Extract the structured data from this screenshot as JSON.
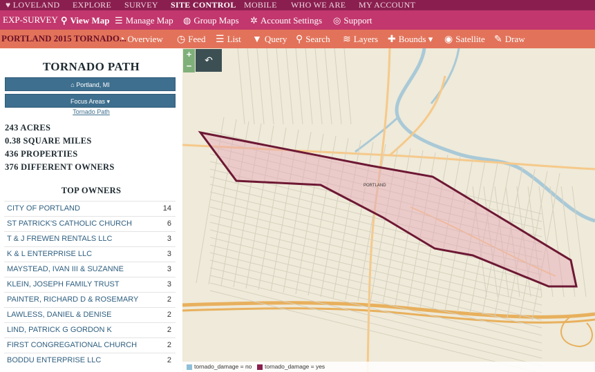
{
  "top_nav": {
    "items": [
      {
        "label": "♥ LOVELAND",
        "active": false
      },
      {
        "label": "EXPLORE",
        "active": false
      },
      {
        "label": "SURVEY",
        "active": false
      },
      {
        "label": "SITE CONTROL",
        "active": true
      },
      {
        "label": "MOBILE",
        "active": false
      },
      {
        "label": "WHO WE ARE",
        "active": false
      },
      {
        "label": "MY ACCOUNT",
        "active": false
      }
    ]
  },
  "sub_nav": {
    "brand": "EXP-SURVEY",
    "links": [
      {
        "label": "View Map",
        "icon": "map-pin-icon",
        "active": true
      },
      {
        "label": "Manage Map",
        "icon": "sliders-icon",
        "active": false
      },
      {
        "label": "Group Maps",
        "icon": "group-icon",
        "active": false
      },
      {
        "label": "Account Settings",
        "icon": "gear-icon",
        "active": false
      },
      {
        "label": "Support",
        "icon": "lifebuoy-icon",
        "active": false
      }
    ]
  },
  "toolbar": {
    "title": "PORTLAND 2015 TORNADO...",
    "tools": [
      {
        "label": "Overview",
        "icon": "pie-chart-icon"
      },
      {
        "label": "Feed",
        "icon": "clock-icon"
      },
      {
        "label": "List",
        "icon": "list-icon"
      },
      {
        "label": "Query",
        "icon": "filter-icon"
      },
      {
        "label": "Search",
        "icon": "search-icon"
      },
      {
        "label": "Layers",
        "icon": "layers-icon"
      },
      {
        "label": "Bounds ▾",
        "icon": "puzzle-icon"
      },
      {
        "label": "Satellite",
        "icon": "globe-icon"
      },
      {
        "label": "Draw",
        "icon": "pencil-icon"
      }
    ]
  },
  "sidebar": {
    "title": "TORNADO PATH",
    "location_button": "⌂ Portland, MI",
    "focus_button": "Focus Areas ▾",
    "focus_link": "Tornado Path",
    "stats": [
      "243 ACRES",
      "0.38 SQUARE MILES",
      "436 PROPERTIES",
      "376 DIFFERENT OWNERS"
    ],
    "owners_title": "TOP OWNERS",
    "owners": [
      {
        "name": "CITY OF PORTLAND",
        "count": "14"
      },
      {
        "name": "ST PATRICK'S CATHOLIC CHURCH",
        "count": "6"
      },
      {
        "name": "T & J FREWEN RENTALS LLC",
        "count": "3"
      },
      {
        "name": "K & L ENTERPRISE LLC",
        "count": "3"
      },
      {
        "name": "MAYSTEAD, IVAN III & SUZANNE",
        "count": "3"
      },
      {
        "name": "KLEIN, JOSEPH FAMILY TRUST",
        "count": "3"
      },
      {
        "name": "PAINTER, RICHARD D & ROSEMARY",
        "count": "2"
      },
      {
        "name": "LAWLESS, DANIEL & DENISE",
        "count": "2"
      },
      {
        "name": "LIND, PATRICK G GORDON K",
        "count": "2"
      },
      {
        "name": "FIRST CONGREGATIONAL CHURCH",
        "count": "2"
      },
      {
        "name": "BODDU ENTERPRISE LLC",
        "count": "2"
      }
    ]
  },
  "map": {
    "zoom_in": "+",
    "zoom_out": "−",
    "back": "↶",
    "town_label": "PORTLAND",
    "colors": {
      "land": "#efead9",
      "water": "#a9c9d7",
      "road": "#f6c98a",
      "highway": "#e8b05d",
      "street": "#d9d4c4",
      "polygon_stroke": "#6d1834",
      "polygon_fill": "#e7a7b6"
    }
  },
  "legend": {
    "items": [
      {
        "label": "tornado_damage = no",
        "color": "#8fc0d8"
      },
      {
        "label": "tornado_damage = yes",
        "color": "#8a1f4f"
      }
    ]
  }
}
